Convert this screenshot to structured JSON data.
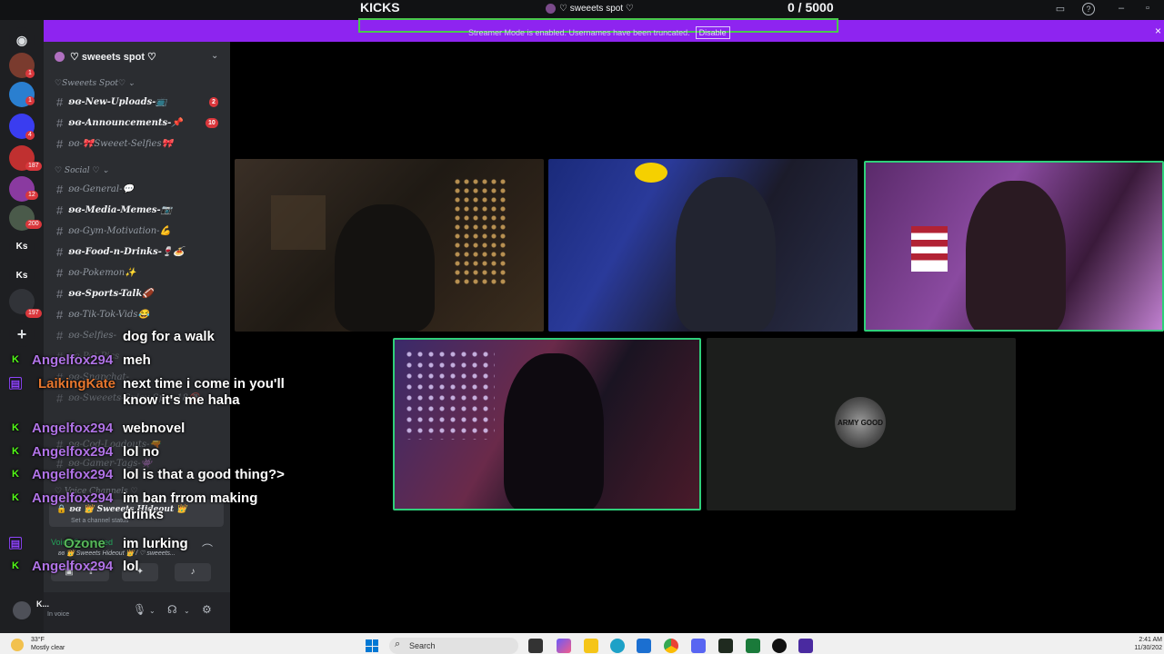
{
  "topbar": {
    "kicks_label": "KICKS",
    "server_title": "♡ sweeets spot ♡",
    "counter": "0  / 5000"
  },
  "banner": {
    "text": "Streamer Mode is enabled. Usernames have been truncated.",
    "disable_label": "Disable",
    "close_glyph": "×",
    "color": "#8e24f0"
  },
  "guilds": [
    {
      "badge": "1"
    },
    {
      "badge": "1"
    },
    {
      "badge": "4"
    },
    {
      "badge": "187"
    },
    {
      "badge": "12"
    },
    {
      "badge": "200"
    },
    {
      "label": "Ks"
    },
    {
      "label": "Ks"
    },
    {
      "badge": "197"
    }
  ],
  "sidebar": {
    "server_name": "♡ sweeets spot ♡",
    "categories": [
      "♡Sweeets Spot♡ ⌄",
      "♡ Social ♡ ⌄"
    ],
    "channels": [
      {
        "name": "ʚɞ-New-Uploads-📺",
        "badge": "2",
        "bright": true
      },
      {
        "name": "ʚɞ-Announcements-📌",
        "badge": "10",
        "bright": true
      },
      {
        "name": "ʚɞ-🎀Sweeet-Selfies🎀",
        "bright": false
      },
      {
        "name": "ʚɞ-General-💬",
        "bright": false
      },
      {
        "name": "ʚɞ-Media-Memes-📷",
        "bright": true
      },
      {
        "name": "ʚɞ-Gym-Motivation-💪",
        "bright": false
      },
      {
        "name": "ʚɞ-Food-n-Drinks-🍷🍝",
        "bright": true
      },
      {
        "name": "ʚɞ-Pokemon✨",
        "bright": false
      },
      {
        "name": "ʚɞ-Sports-Talk🏈",
        "bright": true
      },
      {
        "name": "ʚɞ-Tik-Tok-Vids😂",
        "bright": false
      },
      {
        "name": "ʚɞ-Selfies-",
        "bright": false
      },
      {
        "name": "ʚɞ-Pet-Pics",
        "bright": false
      },
      {
        "name": "ʚɞ-Snapchat-",
        "bright": false
      },
      {
        "name": "ʚɞ-Sweeets-Spicy-Spot-18🔞",
        "bright": false
      },
      {
        "name": "ʚɞ-Cod-Loadouts-🔫",
        "bright": false
      },
      {
        "name": "ʚɞ-Gamer-Tags-👾",
        "bright": false
      }
    ],
    "voice_category": "♡ Voice Channels ♡",
    "voice_channel": "ʚɞ 👑 Sweeets Hideout 👑",
    "voice_channel_sub": "Set a channel status",
    "voice_connected": "Voice Connected",
    "voice_path": "ʚɞ 👑 Sweeets Hideout 👑 / ♡ sweeets...",
    "user_name": "K...",
    "user_status": "In voice"
  },
  "chat": [
    {
      "platform": "",
      "user": "",
      "user_color": "",
      "message": "dog for a walk"
    },
    {
      "platform": "kick",
      "user": "Angelfox294",
      "user_color": "purple",
      "message": "meh"
    },
    {
      "platform": "twitch",
      "user": "LaikingKate",
      "user_color": "orange",
      "message": "next time i come in you'll know it's me haha"
    },
    {
      "platform": "kick",
      "user": "Angelfox294",
      "user_color": "purple",
      "message": "webnovel"
    },
    {
      "platform": "kick",
      "user": "Angelfox294",
      "user_color": "purple",
      "message": "lol no"
    },
    {
      "platform": "kick",
      "user": "Angelfox294",
      "user_color": "purple",
      "message": "lol is that a good thing?>"
    },
    {
      "platform": "kick",
      "user": "Angelfox294",
      "user_color": "purple",
      "message": "im ban frrom making drinks"
    },
    {
      "platform": "twitch",
      "user": "Ozone",
      "user_color": "green",
      "message": "im lurking"
    },
    {
      "platform": "kick",
      "user": "Angelfox294",
      "user_color": "purple",
      "message": "lol"
    }
  ],
  "video_tiles": {
    "logo_text": "ARMY GOOD"
  },
  "taskbar": {
    "weather_temp": "33°F",
    "weather_desc": "Mostly clear",
    "search_placeholder": "Search",
    "time": "2:41 AM",
    "date": "11/30/202"
  },
  "colors": {
    "kick_green": "#53fc18",
    "twitch_purple": "#9146ff",
    "speaking_border": "#2fcf7a"
  }
}
